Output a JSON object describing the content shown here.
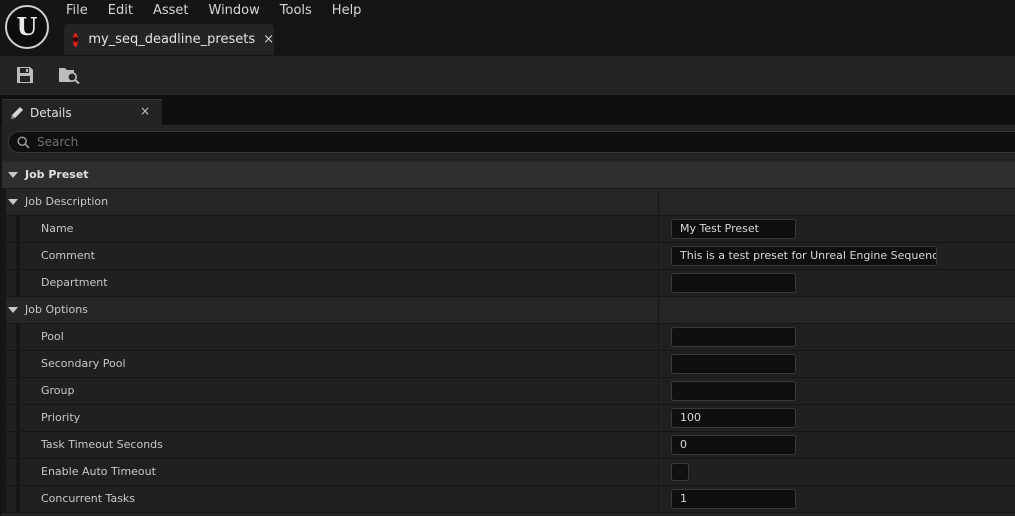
{
  "app": {
    "logo_letter": "U",
    "menu": [
      "File",
      "Edit",
      "Asset",
      "Window",
      "Tools",
      "Help"
    ],
    "document_tab": {
      "label": "my_seq_deadline_presets",
      "close": "×"
    }
  },
  "toolbar": {
    "buttons": [
      "save-icon",
      "browse-to-asset-icon"
    ]
  },
  "details_panel": {
    "tab_label": "Details",
    "tab_close": "×",
    "search": {
      "placeholder": "Search",
      "value": ""
    },
    "sections": {
      "job_preset": "Job Preset",
      "job_description": "Job Description",
      "job_options": "Job Options"
    },
    "properties": {
      "name": {
        "label": "Name",
        "value": "My Test Preset"
      },
      "comment": {
        "label": "Comment",
        "value": "This is a test preset for Unreal Engine Sequencer."
      },
      "department": {
        "label": "Department",
        "value": ""
      },
      "pool": {
        "label": "Pool",
        "value": ""
      },
      "secondary_pool": {
        "label": "Secondary Pool",
        "value": ""
      },
      "group": {
        "label": "Group",
        "value": ""
      },
      "priority": {
        "label": "Priority",
        "value": "100"
      },
      "task_timeout_seconds": {
        "label": "Task Timeout Seconds",
        "value": "0"
      },
      "enable_auto_timeout": {
        "label": "Enable Auto Timeout",
        "checked": false
      },
      "concurrent_tasks": {
        "label": "Concurrent Tasks",
        "value": "1"
      }
    }
  },
  "colors": {
    "accent_red": "#e01d1d",
    "panel_bg": "#242424",
    "field_bg": "#0f0f0f"
  }
}
